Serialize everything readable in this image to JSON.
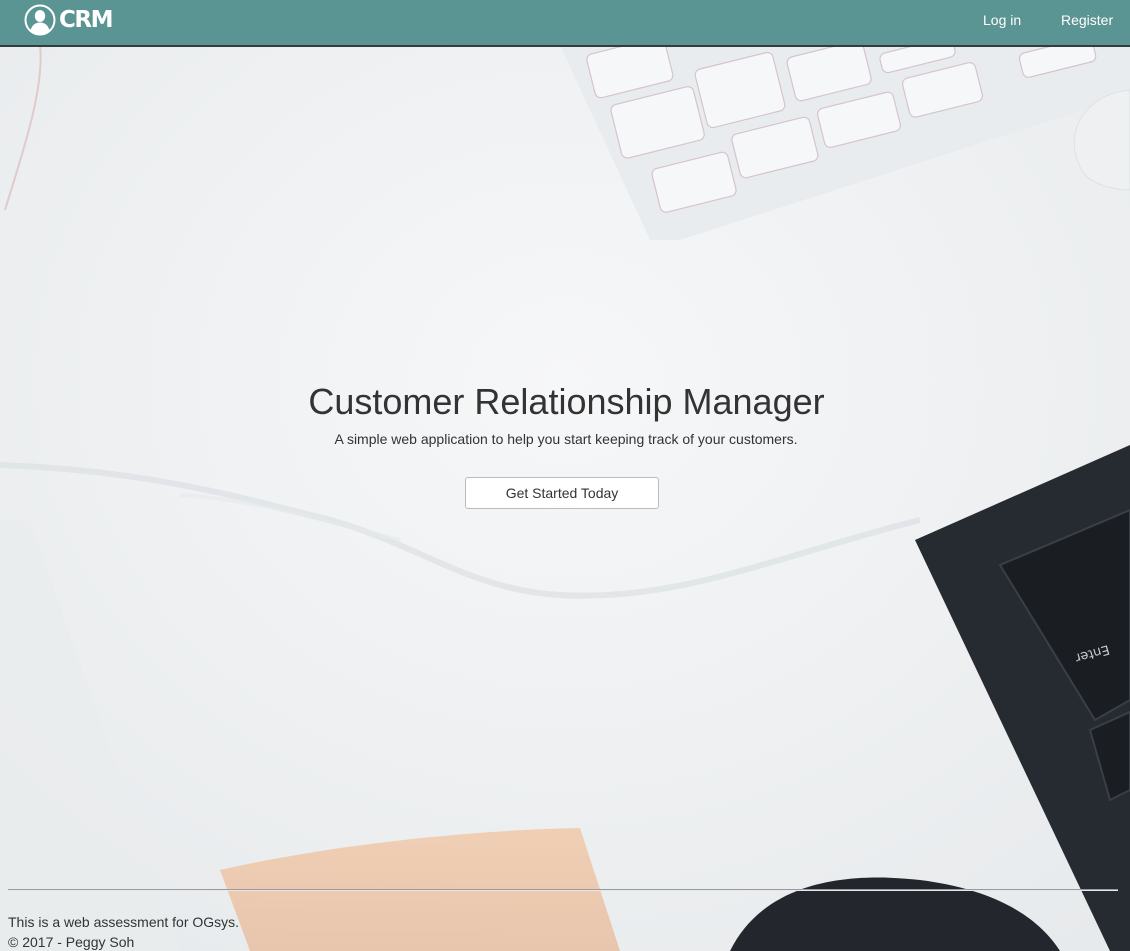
{
  "nav": {
    "brand_text": "CRM",
    "brand_icon": "user-silhouette-icon",
    "login_label": "Log in",
    "register_label": "Register"
  },
  "hero": {
    "title": "Customer Relationship Manager",
    "subtitle": "A simple web application to help you start keeping track of your customers.",
    "cta_label": "Get Started Today"
  },
  "footer": {
    "line1": "This is a web assessment for OGsys.",
    "line2": "© 2017 - Peggy Soh"
  },
  "colors": {
    "navbar": "#5a9493",
    "navbar_border": "#333d3d",
    "text": "#333333",
    "background": "#f1f3f4"
  }
}
